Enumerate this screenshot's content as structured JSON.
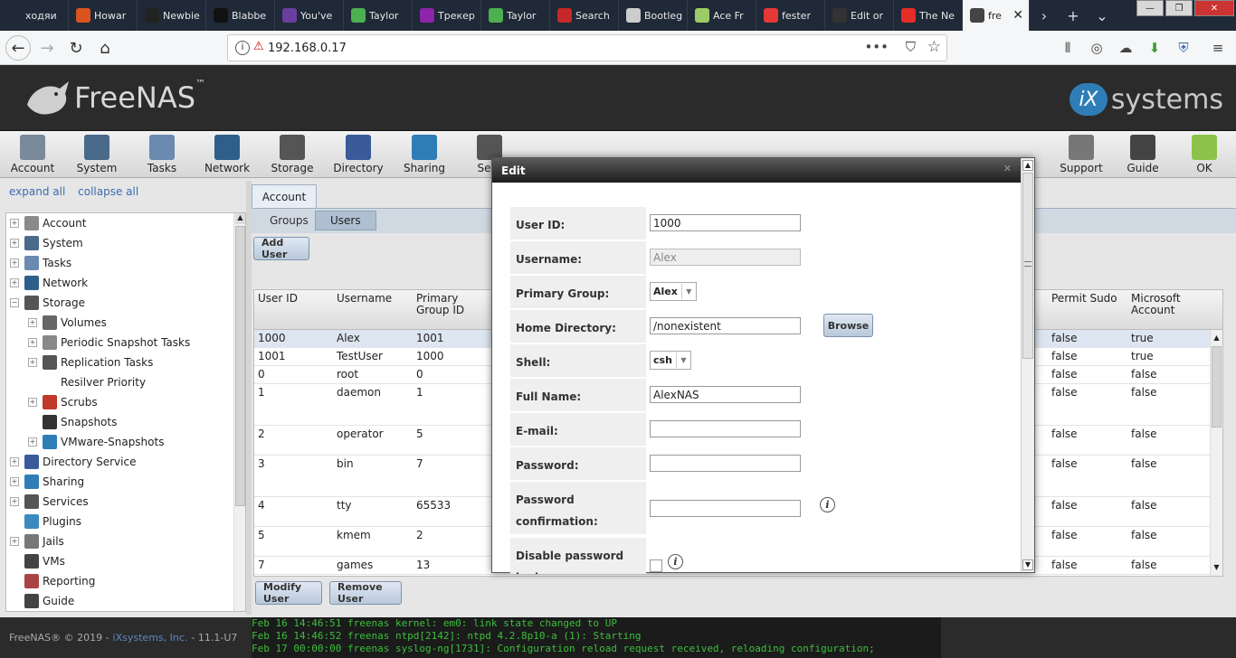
{
  "browser": {
    "tabs": [
      {
        "label": "ходяи",
        "color": "#1f2937"
      },
      {
        "label": "Howar",
        "color": "#d9541e"
      },
      {
        "label": "Newbie",
        "color": "#222222"
      },
      {
        "label": "Blabbe",
        "color": "#111111"
      },
      {
        "label": "You've",
        "color": "#6a3fa0"
      },
      {
        "label": "Taylor",
        "color": "#4caf50"
      },
      {
        "label": "Трекер",
        "color": "#8e24aa"
      },
      {
        "label": "Taylor",
        "color": "#4caf50"
      },
      {
        "label": "Search",
        "color": "#c62828"
      },
      {
        "label": "Bootleg",
        "color": "#cccccc"
      },
      {
        "label": "Ace Fr",
        "color": "#9ccc65"
      },
      {
        "label": "fester",
        "color": "#e53935"
      },
      {
        "label": "Edit or",
        "color": "#333333"
      },
      {
        "label": "The Ne",
        "color": "#e52d27"
      },
      {
        "label": "fre",
        "color": "#444444"
      }
    ],
    "url": "192.168.0.17",
    "window_controls": {
      "minimize": "—",
      "maximize": "❐",
      "close": "✕"
    }
  },
  "header": {
    "logo_text": "FreeNAS",
    "logo_tm": "™",
    "brand_ix": "iX",
    "brand_text": "systems"
  },
  "toolbar": {
    "items": [
      {
        "label": "Account",
        "color": "#7a8a9a"
      },
      {
        "label": "System",
        "color": "#4a6a8a"
      },
      {
        "label": "Tasks",
        "color": "#6a8ab0"
      },
      {
        "label": "Network",
        "color": "#2e5f8a"
      },
      {
        "label": "Storage",
        "color": "#555555"
      },
      {
        "label": "Directory",
        "color": "#3a5a9a"
      },
      {
        "label": "Sharing",
        "color": "#2f7db6"
      },
      {
        "label": "Serv",
        "color": "#555555"
      },
      {
        "label": "Support",
        "color": "#777777"
      },
      {
        "label": "Guide",
        "color": "#444444"
      },
      {
        "label": "OK",
        "color": "#8bc34a"
      }
    ]
  },
  "tree": {
    "expand_all": "expand all",
    "collapse_all": "collapse all",
    "nodes": [
      {
        "label": "Account",
        "toggle": "+",
        "indent": 0,
        "color": "#8a8a8a"
      },
      {
        "label": "System",
        "toggle": "+",
        "indent": 0,
        "color": "#4a6a8a"
      },
      {
        "label": "Tasks",
        "toggle": "+",
        "indent": 0,
        "color": "#6a8ab0"
      },
      {
        "label": "Network",
        "toggle": "+",
        "indent": 0,
        "color": "#2e5f8a"
      },
      {
        "label": "Storage",
        "toggle": "−",
        "indent": 0,
        "color": "#555555"
      },
      {
        "label": "Volumes",
        "toggle": "+",
        "indent": 1,
        "color": "#666666"
      },
      {
        "label": "Periodic Snapshot Tasks",
        "toggle": "+",
        "indent": 1,
        "color": "#888888"
      },
      {
        "label": "Replication Tasks",
        "toggle": "+",
        "indent": 1,
        "color": "#555555"
      },
      {
        "label": "Resilver Priority",
        "toggle": "",
        "indent": 2,
        "color": ""
      },
      {
        "label": "Scrubs",
        "toggle": "+",
        "indent": 1,
        "color": "#c0392b"
      },
      {
        "label": "Snapshots",
        "toggle": "",
        "indent": 1,
        "color": "#333333"
      },
      {
        "label": "VMware-Snapshots",
        "toggle": "+",
        "indent": 1,
        "color": "#2f7db6"
      },
      {
        "label": "Directory Service",
        "toggle": "+",
        "indent": 0,
        "color": "#3a5a9a"
      },
      {
        "label": "Sharing",
        "toggle": "+",
        "indent": 0,
        "color": "#2f7db6"
      },
      {
        "label": "Services",
        "toggle": "+",
        "indent": 0,
        "color": "#555555"
      },
      {
        "label": "Plugins",
        "toggle": "",
        "indent": 0,
        "color": "#3a8ac0"
      },
      {
        "label": "Jails",
        "toggle": "+",
        "indent": 0,
        "color": "#777777"
      },
      {
        "label": "VMs",
        "toggle": "",
        "indent": 0,
        "color": "#444444"
      },
      {
        "label": "Reporting",
        "toggle": "",
        "indent": 0,
        "color": "#aa4444"
      },
      {
        "label": "Guide",
        "toggle": "",
        "indent": 0,
        "color": "#444444"
      }
    ]
  },
  "main": {
    "tab": "Account",
    "subtabs": [
      "Groups",
      "Users"
    ],
    "add_user": "Add User",
    "modify_user": "Modify User",
    "remove_user": "Remove User",
    "columns": {
      "user_id": "User ID",
      "username": "Username",
      "primary_group": "Primary Group ID",
      "permit_sudo": "Permit Sudo",
      "microsoft": "Microsoft Account"
    },
    "rows": [
      {
        "id": "1000",
        "user": "Alex",
        "gid": "1001",
        "sudo": "false",
        "ms": "true",
        "h": 20
      },
      {
        "id": "1001",
        "user": "TestUser",
        "gid": "1000",
        "sudo": "false",
        "ms": "true",
        "h": 20
      },
      {
        "id": "0",
        "user": "root",
        "gid": "0",
        "sudo": "false",
        "ms": "false",
        "h": 20
      },
      {
        "id": "1",
        "user": "daemon",
        "gid": "1",
        "sudo": "false",
        "ms": "false",
        "h": 46
      },
      {
        "id": "2",
        "user": "operator",
        "gid": "5",
        "sudo": "false",
        "ms": "false",
        "h": 33
      },
      {
        "id": "3",
        "user": "bin",
        "gid": "7",
        "sudo": "false",
        "ms": "false",
        "h": 46
      },
      {
        "id": "4",
        "user": "tty",
        "gid": "65533",
        "sudo": "false",
        "ms": "false",
        "h": 33
      },
      {
        "id": "5",
        "user": "kmem",
        "gid": "2",
        "sudo": "false",
        "ms": "false",
        "h": 33
      },
      {
        "id": "7",
        "user": "games",
        "gid": "13",
        "sudo": "false",
        "ms": "false",
        "h": 20
      }
    ]
  },
  "footer": {
    "copyright": "FreeNAS® © 2019 -",
    "company": "iXsystems, Inc.",
    "version": "- 11.1-U7"
  },
  "console": {
    "lines": [
      "Feb 16 14:46:51 freenas kernel: em0: link state changed to UP",
      "Feb 16 14:46:52 freenas ntpd[2142]: ntpd 4.2.8p10-a (1): Starting",
      "Feb 17 00:00:00 freenas syslog-ng[1731]: Configuration reload request received, reloading configuration;"
    ]
  },
  "modal": {
    "title": "Edit",
    "close": "✕",
    "fields": {
      "user_id_label": "User ID:",
      "user_id_value": "1000",
      "username_label": "Username:",
      "username_value": "Alex",
      "group_label": "Primary Group:",
      "group_value": "Alex",
      "home_label": "Home Directory:",
      "home_value": "/nonexistent",
      "browse": "Browse",
      "shell_label": "Shell:",
      "shell_value": "csh",
      "fullname_label": "Full Name:",
      "fullname_value": "AlexNAS",
      "email_label": "E-mail:",
      "email_value": "",
      "password_label": "Password:",
      "password_value": "",
      "confirm_label": "Password confirmation:",
      "confirm_value": "",
      "disable_label": "Disable password login:",
      "info": "i"
    }
  }
}
